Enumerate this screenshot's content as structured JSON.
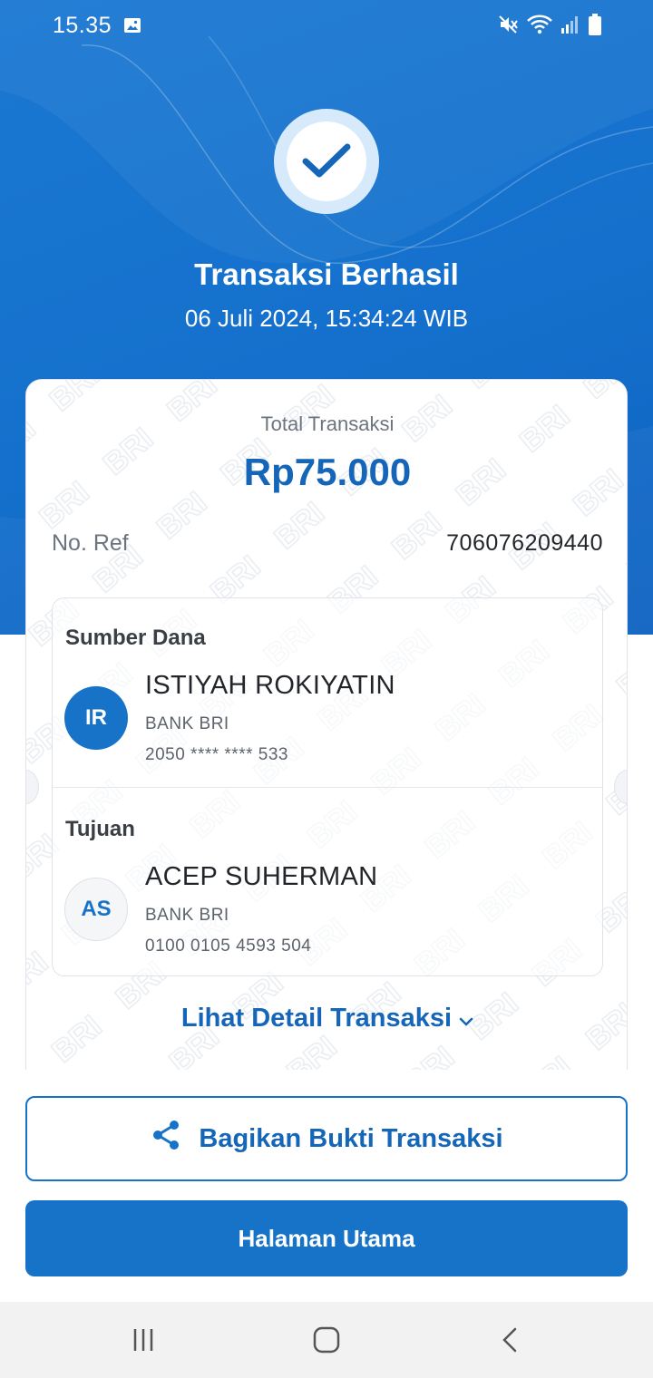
{
  "status_bar": {
    "time": "15.35",
    "icons": [
      "image-icon",
      "mute-icon",
      "wifi-icon",
      "signal-icon",
      "battery-icon"
    ]
  },
  "header": {
    "title": "Transaksi Berhasil",
    "datetime": "06 Juli 2024, 15:34:24 WIB",
    "status_icon": "check-icon"
  },
  "receipt": {
    "total_label": "Total Transaksi",
    "total_amount": "Rp75.000",
    "ref_label": "No. Ref",
    "ref_value": "706076209440",
    "watermark_text": "BRI",
    "source": {
      "label": "Sumber Dana",
      "initials": "IR",
      "name": "ISTIYAH ROKIYATIN",
      "bank": "BANK BRI",
      "account": "2050 **** **** 533"
    },
    "destination": {
      "label": "Tujuan",
      "initials": "AS",
      "name": "ACEP SUHERMAN",
      "bank": "BANK BRI",
      "account": "0100 0105 4593 504"
    },
    "detail_link": "Lihat Detail Transaksi"
  },
  "actions": {
    "share_label": "Bagikan Bukti Transaksi",
    "home_label": "Halaman Utama"
  },
  "nav": {
    "icons": [
      "recent-apps-icon",
      "home-icon",
      "back-icon"
    ]
  },
  "colors": {
    "primary": "#1673c8",
    "primary_text": "#1566b8",
    "hero_bg": "#1470cc"
  }
}
